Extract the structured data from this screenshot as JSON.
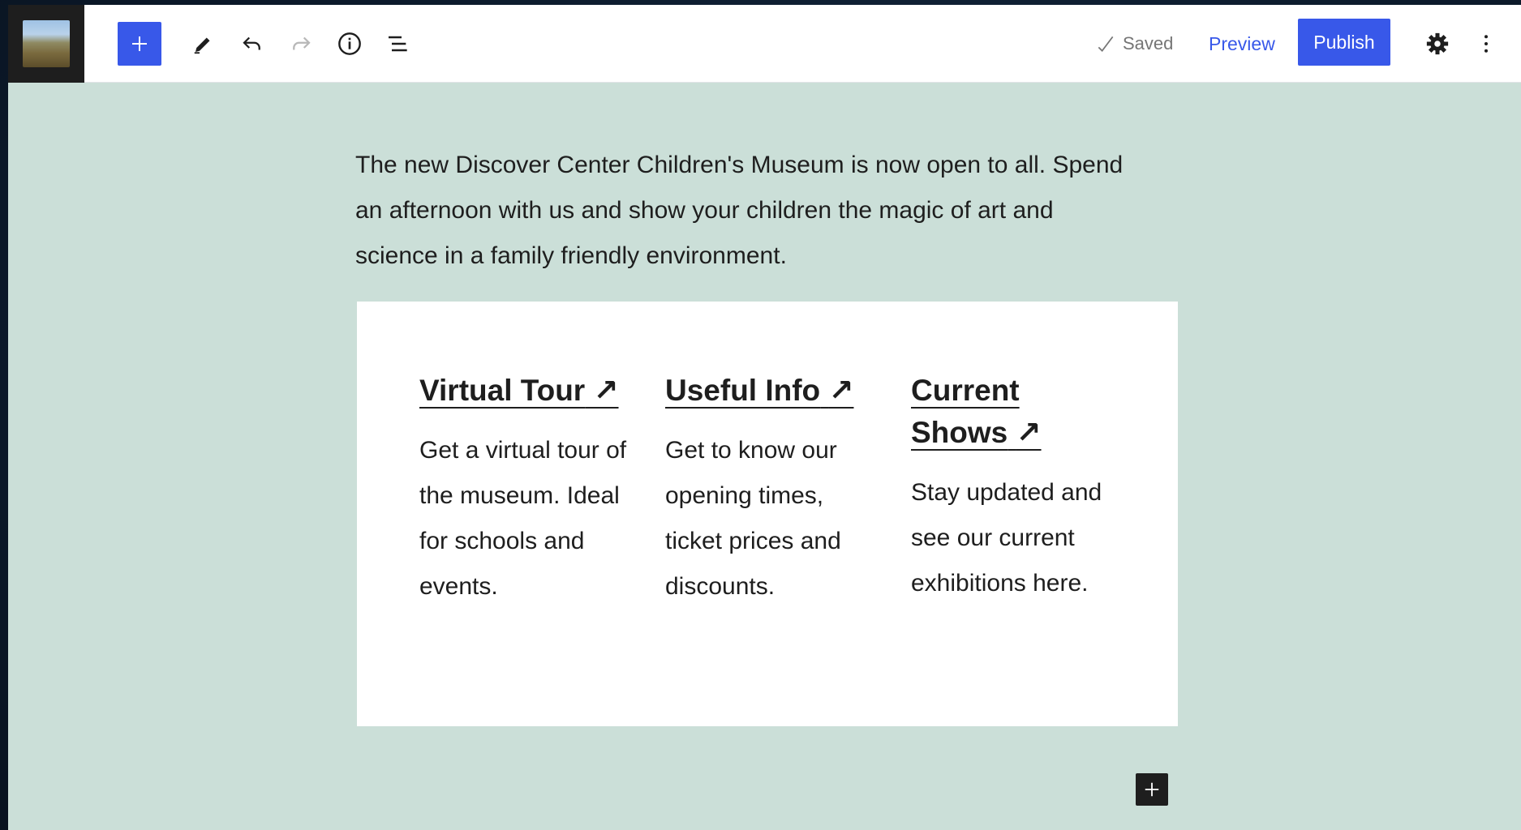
{
  "toolbar": {
    "saved_label": "Saved",
    "preview_label": "Preview",
    "publish_label": "Publish",
    "icons": [
      "site-logo",
      "plus-icon",
      "pencil-icon",
      "undo-icon",
      "redo-icon",
      "info-icon",
      "list-view-icon",
      "check-icon",
      "gear-icon",
      "more-vertical-icon"
    ]
  },
  "content": {
    "intro": "The new Discover Center Children's Museum is now open to all. Spend an afternoon with us and show your children the magic of art and science in a family friendly environment.",
    "columns": [
      {
        "title": "Virtual Tour",
        "arrow": "↗",
        "text": "Get a virtual tour of the museum. Ideal for schools and events."
      },
      {
        "title": "Useful Info",
        "arrow": "↗",
        "text": "Get to know our opening times, ticket prices and discounts."
      },
      {
        "title": "Current Shows",
        "arrow": "↗",
        "text": "Stay updated and see our current exhibitions here."
      }
    ]
  },
  "colors": {
    "accent": "#3858e9",
    "canvas_bg": "#cbdfd8",
    "text": "#1e1e1e"
  }
}
